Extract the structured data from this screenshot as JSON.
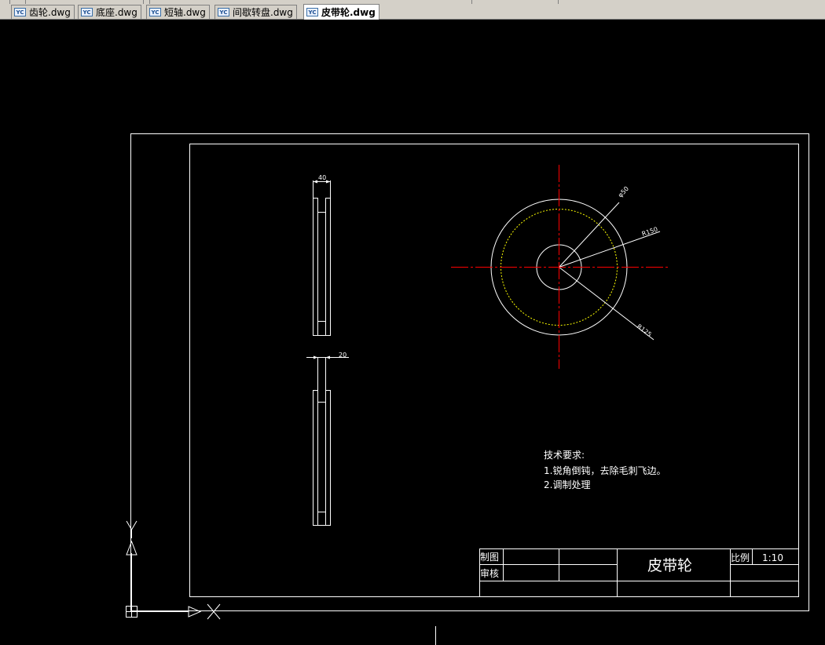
{
  "tabs": [
    {
      "label": "齿轮.dwg",
      "active": false
    },
    {
      "label": "底座.dwg",
      "active": false
    },
    {
      "label": "短轴.dwg",
      "active": false
    },
    {
      "label": "间歇转盘.dwg",
      "active": false
    },
    {
      "label": "皮带轮.dwg",
      "active": true
    }
  ],
  "tab_icon": "dwg-file-icon",
  "drawing": {
    "dimensions": {
      "width_top": "40",
      "width_bottom": "20",
      "dia_small": "φ50",
      "radius_pitch": "R150",
      "radius_outer": "R125"
    },
    "tech_requirements": {
      "title": "技术要求:",
      "item1": "1.锐角倒钝，去除毛刺飞边。",
      "item2": "2.调制处理"
    },
    "title_block": {
      "drawn_label": "制图",
      "checked_label": "审核",
      "part_name": "皮带轮",
      "scale_label": "比例",
      "scale_value": "1:10"
    }
  },
  "colors": {
    "background": "#000000",
    "lines": "#ffffff",
    "centerline": "#ff0000",
    "pitch_circle": "#ffff00"
  },
  "ucs_icon": "ucs-axes-icon"
}
